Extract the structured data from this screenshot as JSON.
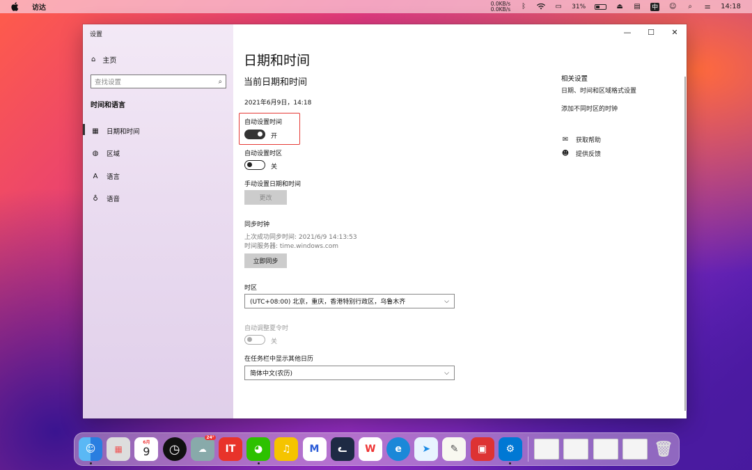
{
  "menubar": {
    "app_name": "访达",
    "net_up": "0.0KB/s",
    "net_down": "0.0KB/s",
    "battery": "31%",
    "ime": "中",
    "time": "14:18"
  },
  "window": {
    "title": "设置",
    "controls": {
      "minimize": "—",
      "maximize": "☐",
      "close": "✕"
    }
  },
  "sidebar": {
    "home_label": "主页",
    "search_placeholder": "查找设置",
    "section_title": "时间和语言",
    "items": [
      {
        "label": "日期和时间",
        "icon": "calendar-icon",
        "active": true
      },
      {
        "label": "区域",
        "icon": "globe-icon",
        "active": false
      },
      {
        "label": "语言",
        "icon": "language-icon",
        "active": false
      },
      {
        "label": "语音",
        "icon": "microphone-icon",
        "active": false
      }
    ]
  },
  "main": {
    "page_title": "日期和时间",
    "section_current": "当前日期和时间",
    "current_datetime": "2021年6月9日，14:18",
    "auto_time": {
      "label": "自动设置时间",
      "state": "开",
      "on": true
    },
    "auto_timezone": {
      "label": "自动设置时区",
      "state": "关",
      "on": false
    },
    "manual": {
      "label": "手动设置日期和时间",
      "button": "更改"
    },
    "sync": {
      "title": "同步时钟",
      "last_sync": "上次成功同步时间: 2021/6/9 14:13:53",
      "server": "时间服务器: time.windows.com",
      "button": "立即同步"
    },
    "timezone": {
      "label": "时区",
      "value": "(UTC+08:00) 北京，重庆，香港特别行政区，乌鲁木齐"
    },
    "dst": {
      "label": "自动调整夏令时",
      "state": "关",
      "on": false
    },
    "calendar": {
      "label": "在任务栏中显示其他日历",
      "value": "简体中文(农历)"
    }
  },
  "related": {
    "title": "相关设置",
    "links": [
      "日期、时间和区域格式设置",
      "添加不同时区的时钟"
    ],
    "help": [
      {
        "label": "获取帮助",
        "icon": "help-chat-icon"
      },
      {
        "label": "提供反馈",
        "icon": "feedback-icon"
      }
    ]
  },
  "dock": {
    "calendar_month": "6月",
    "calendar_day": "9",
    "weather_temp": "24°"
  },
  "colors": {
    "highlight_border": "#e53935",
    "toggle_on": "#333333"
  }
}
